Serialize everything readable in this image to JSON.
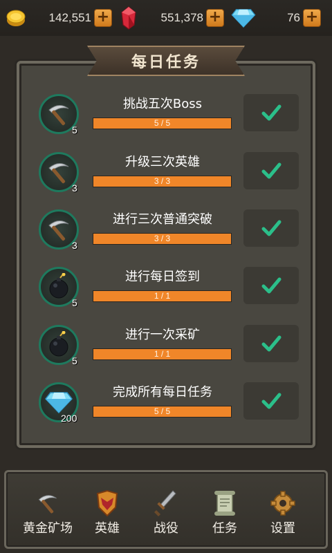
{
  "resources": {
    "gold": {
      "icon": "gold-coin-icon",
      "value": "142,551"
    },
    "ruby": {
      "icon": "ruby-gem-icon",
      "value": "551,378"
    },
    "diamond": {
      "icon": "diamond-icon",
      "value": "76"
    },
    "plus_label": "+"
  },
  "panel": {
    "title": "每日任务"
  },
  "tasks": [
    {
      "title": "挑战五次Boss",
      "progress": "5 / 5",
      "fraction": 1.0,
      "reward_icon": "pickaxe-icon",
      "reward_count": "5",
      "claimed": true
    },
    {
      "title": "升级三次英雄",
      "progress": "3 / 3",
      "fraction": 1.0,
      "reward_icon": "pickaxe-icon",
      "reward_count": "3",
      "claimed": true
    },
    {
      "title": "进行三次普通突破",
      "progress": "3 / 3",
      "fraction": 1.0,
      "reward_icon": "pickaxe-icon",
      "reward_count": "3",
      "claimed": true
    },
    {
      "title": "进行每日签到",
      "progress": "1 / 1",
      "fraction": 1.0,
      "reward_icon": "bomb-icon",
      "reward_count": "5",
      "claimed": true
    },
    {
      "title": "进行一次采矿",
      "progress": "1 / 1",
      "fraction": 1.0,
      "reward_icon": "bomb-icon",
      "reward_count": "5",
      "claimed": true
    },
    {
      "title": "完成所有每日任务",
      "progress": "5 / 5",
      "fraction": 1.0,
      "reward_icon": "diamond-icon",
      "reward_count": "200",
      "claimed": true
    }
  ],
  "nav": [
    {
      "label": "黄金矿场",
      "icon": "pickaxe-icon"
    },
    {
      "label": "英雄",
      "icon": "hero-shield-icon"
    },
    {
      "label": "战役",
      "icon": "sword-icon"
    },
    {
      "label": "任务",
      "icon": "scroll-icon"
    },
    {
      "label": "设置",
      "icon": "gear-icon"
    }
  ],
  "colors": {
    "progress": "#f08629",
    "check": "#2bbf8a",
    "panel": "#494740",
    "icon_ring": "#1e7a5e"
  }
}
